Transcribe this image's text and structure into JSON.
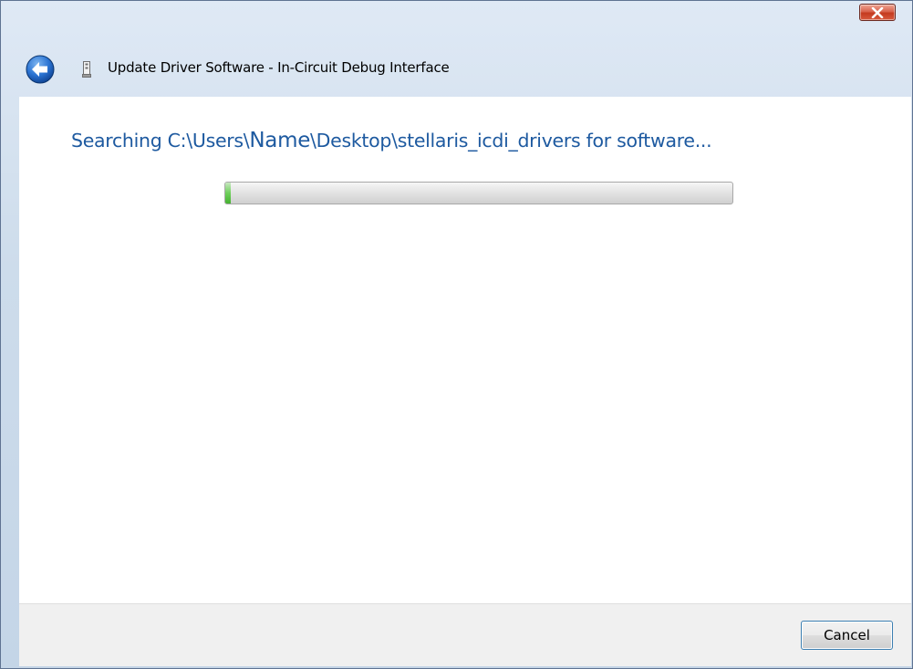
{
  "window": {
    "title": "Update Driver Software - In-Circuit Debug Interface",
    "close_icon": "close-x-icon",
    "back_icon": "back-arrow-icon",
    "device_icon": "usb-device-icon"
  },
  "main": {
    "heading_prefix": "Searching C:\\Users\\",
    "heading_name": "Name",
    "heading_suffix": "\\Desktop\\stellaris_icdi_drivers for software...",
    "progress_fraction": 0.01
  },
  "footer": {
    "cancel_label": "Cancel"
  },
  "colors": {
    "heading": "#1e5aa0",
    "progress_green": "#45b230",
    "close_red": "#c43a1f",
    "back_blue": "#1c66c9"
  }
}
